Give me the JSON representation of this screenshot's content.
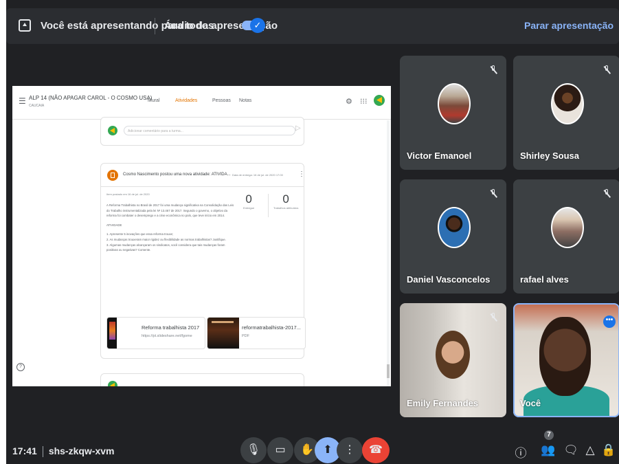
{
  "presenting_bar": {
    "presenting_text": "Você está apresentando para todos",
    "audio_text": "Áudio da apresentação",
    "audio_toggle": "✓",
    "stop_label": "Parar apresentação"
  },
  "classroom": {
    "class_name": "ALP 14 (NÃO APAGAR CAROL - O COSMO USA)",
    "class_sub": "CAUCAIA",
    "tabs": [
      {
        "label": "Mural",
        "active": false
      },
      {
        "label": "Atividades",
        "active": true
      },
      {
        "label": "Pessoas",
        "active": false
      },
      {
        "label": "Notas",
        "active": false
      }
    ],
    "comment_placeholder": "Adicionar comentário para a turma...",
    "post": {
      "title": "Cosmo Nascimento postou uma nova atividade: ATIVIDA...",
      "due": "Data de entrega: 16 de jul. de 2020 17:00",
      "posted_date": "Item postado em 16 de jul. de 2020",
      "body_p1": "A Reforma Trabalhista no Brasil de 2017 foi uma mudança significativa na Consolidação das Leis do Trabalho instrumentalizada pela lei Nº 13.467 de 2017. Segundo o governo, o objetivo da reforma foi combater o desemprego e a crise econômica no país, que teve início em 2014.",
      "body_heading": "ATIVIDADE",
      "body_q1": "1. Apresente 5 inovações que essa reforma trouxe;",
      "body_q2": "2. As mudanças trouxeram maior rigidez ou flexibilidade as normas trabalhistas? Justifique.",
      "body_q3": "3. Algumas mudanças alcançaram os sindicatos, você considera que tais mudanças foram positivas ou negativas? Comente.",
      "stat_turned_in": {
        "value": "0",
        "label": "Entregue"
      },
      "stat_assigned": {
        "value": "0",
        "label": "Trabalhos atribuídos"
      },
      "attachments": [
        {
          "title": "Reforma trabalhista 2017",
          "subtitle": "https://pt.slideshare.net/fgome"
        },
        {
          "title": "reformatrabalhista-2017...",
          "subtitle": "PDF"
        }
      ]
    },
    "help": "?"
  },
  "participants": [
    {
      "name": "Victor Emanoel"
    },
    {
      "name": "Shirley Sousa"
    },
    {
      "name": "Daniel Vasconcelos"
    },
    {
      "name": "rafael alves"
    },
    {
      "name": "Emily Fernandes"
    },
    {
      "name": "Você"
    }
  ],
  "bottom_bar": {
    "time": "17:41",
    "meeting_code": "shs-zkqw-xvm",
    "participant_count": "7"
  },
  "colors": {
    "background": "#202124",
    "accent": "#8ab4f8",
    "hangup": "#ea4335",
    "classroom_accent": "#e37400"
  }
}
